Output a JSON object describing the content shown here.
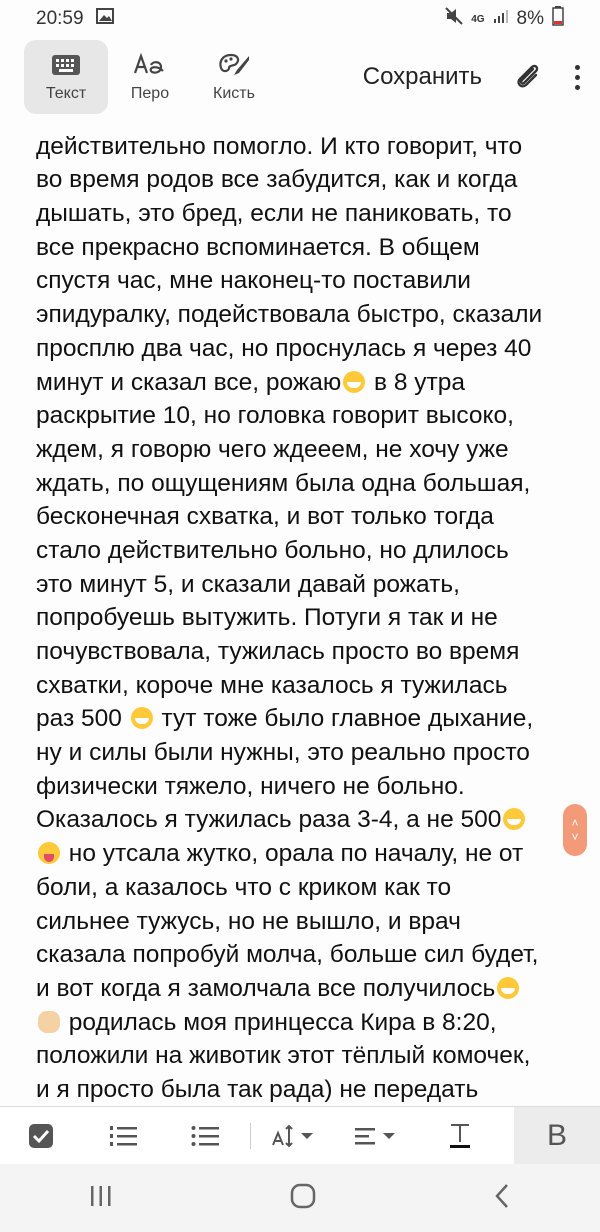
{
  "status": {
    "time": "20:59",
    "network": "4G",
    "battery": "8%"
  },
  "toolbar": {
    "tools": [
      {
        "label": "Текст"
      },
      {
        "label": "Перо"
      },
      {
        "label": "Кисть"
      }
    ],
    "save_label": "Сохранить"
  },
  "content": {
    "lines": [
      "действительно помогло. И кто говорит, что",
      "во время родов все забудится, как и когда",
      "дышать, это бред, если не паниковать, то",
      "все прекрасно вспоминается.  В общем",
      "спустя час, мне  наконец-то  поставили",
      "эпидуралку, подействовала быстро, сказали",
      "просплю два час, но проснулась я через 40",
      "минут и сказал все, рожаю",
      " в 8 утра",
      "раскрытие 10, но головка говорит высоко,",
      "ждем, я говорю чего ждееем, не хочу уже",
      "ждать, по ощущениям была одна большая,",
      "бесконечная схватка, и вот только тогда",
      "стало действительно больно, но длилось",
      "это минут 5, и сказали давай рожать,",
      "попробуешь вытужить. Потуги я так и не",
      "почувствовала, тужилась просто во время",
      "схватки,  короче мне казалось я тужилась",
      "раз 500 ",
      " тут тоже было главное дыхание,",
      "ну и силы были нужны, это реально просто",
      "физически тяжело, ничего не больно.",
      "Оказалось я тужилась раза 3-4, а не 500",
      " но утсала жутко, орала по началу, не от",
      "боли, а казалось что с криком как то",
      "сильнее тужусь, но не вышло, и врач",
      "сказала попробуй молча, больше сил будет,",
      "и вот когда я замолчала  все получилось",
      " родилась моя принцесса Кира в 8:20,",
      "положили на животик этот тёплый комочек,",
      "и я просто была так рада) не передать"
    ]
  }
}
